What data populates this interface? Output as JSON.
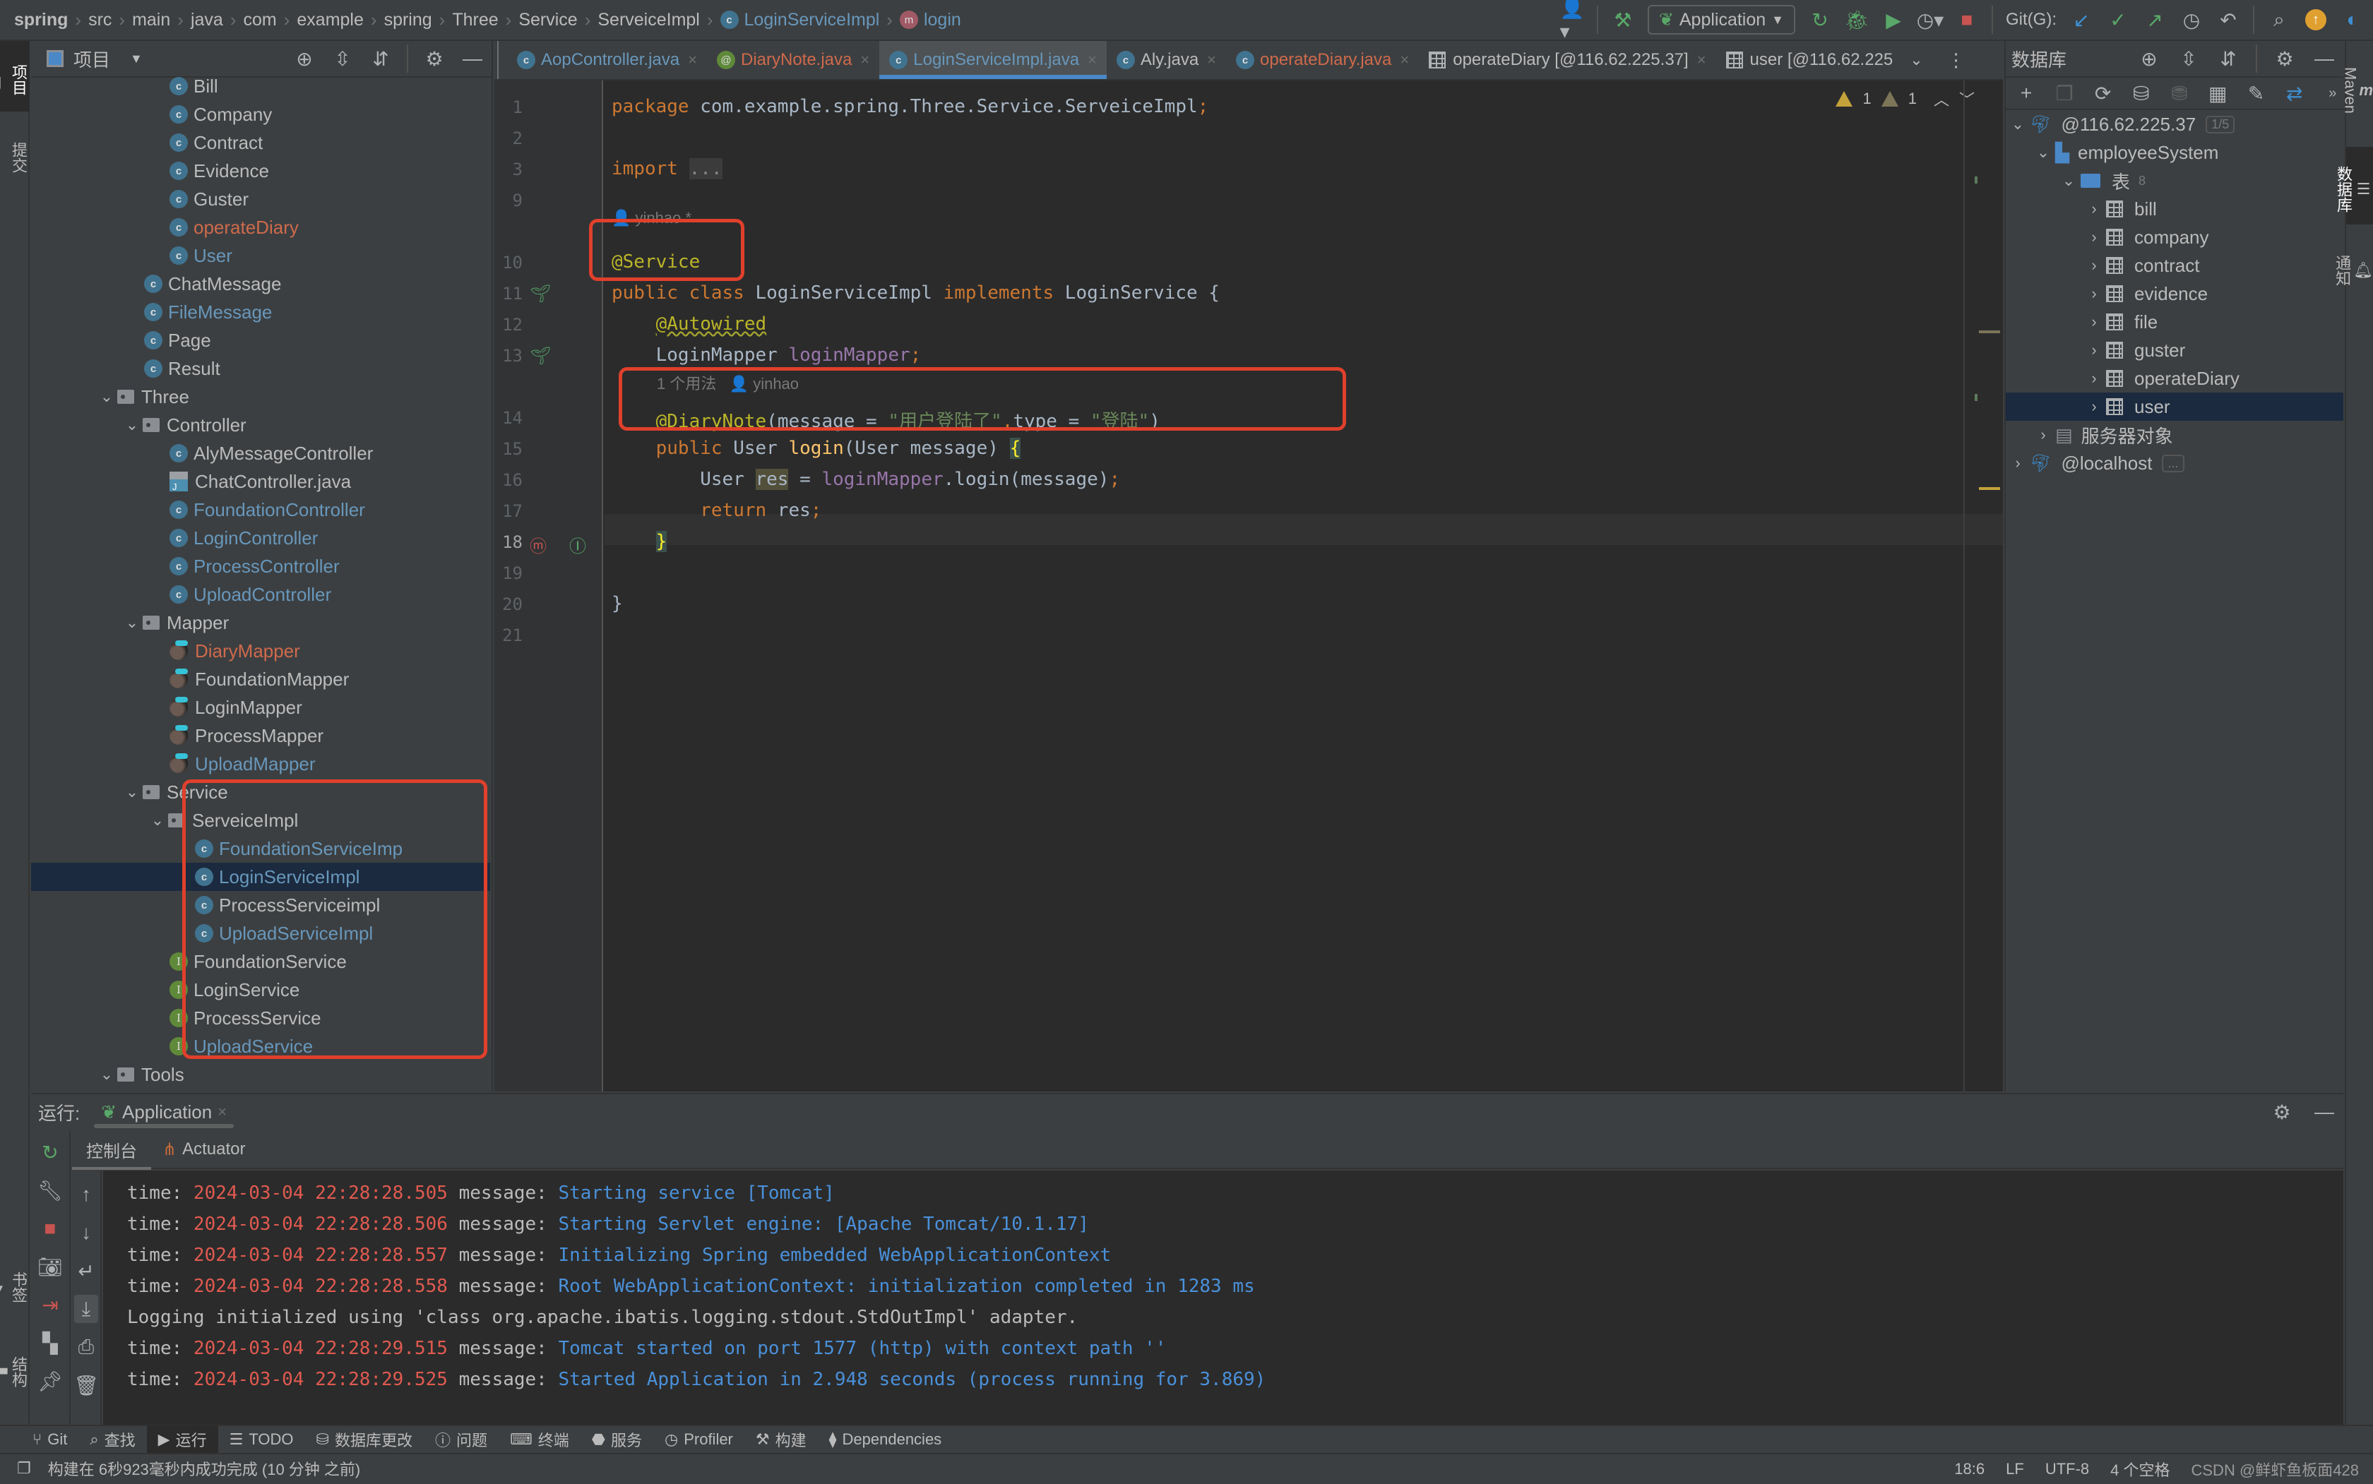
{
  "navbar": {
    "breadcrumbs": [
      "spring",
      "src",
      "main",
      "java",
      "com",
      "example",
      "spring",
      "Three",
      "Service",
      "ServeiceImpl"
    ],
    "class_crumb": "LoginServiceImpl",
    "method_crumb": "login",
    "run_config": "Application",
    "git_label": "Git(G):"
  },
  "left_strip": {
    "project_tab": "项目",
    "commit_tab": "提交",
    "bookmarks_tab": "书签",
    "structure_tab": "结构"
  },
  "project": {
    "title": "项目",
    "tree": [
      {
        "label": "Bill",
        "indent": 5,
        "icon": "class",
        "color": "def"
      },
      {
        "label": "Company",
        "indent": 5,
        "icon": "class",
        "color": "def"
      },
      {
        "label": "Contract",
        "indent": 5,
        "icon": "class",
        "color": "def"
      },
      {
        "label": "Evidence",
        "indent": 5,
        "icon": "class",
        "color": "def"
      },
      {
        "label": "Guster",
        "indent": 5,
        "icon": "class",
        "color": "def"
      },
      {
        "label": "operateDiary",
        "indent": 5,
        "icon": "class",
        "color": "red"
      },
      {
        "label": "User",
        "indent": 5,
        "icon": "class",
        "color": "blue"
      },
      {
        "label": "ChatMessage",
        "indent": 4,
        "icon": "class",
        "color": "def"
      },
      {
        "label": "FileMessage",
        "indent": 4,
        "icon": "class",
        "color": "blue"
      },
      {
        "label": "Page",
        "indent": 4,
        "icon": "class",
        "color": "def"
      },
      {
        "label": "Result",
        "indent": 4,
        "icon": "class",
        "color": "def"
      },
      {
        "label": "Three",
        "indent": 3,
        "icon": "folder",
        "color": "def",
        "expanded": true
      },
      {
        "label": "Controller",
        "indent": 4,
        "icon": "folder",
        "color": "def",
        "expanded": true
      },
      {
        "label": "AlyMessageController",
        "indent": 5,
        "icon": "class",
        "color": "def"
      },
      {
        "label": "ChatController.java",
        "indent": 5,
        "icon": "javafile",
        "color": "def"
      },
      {
        "label": "FoundationController",
        "indent": 5,
        "icon": "class",
        "color": "blue"
      },
      {
        "label": "LoginController",
        "indent": 5,
        "icon": "class",
        "color": "blue"
      },
      {
        "label": "ProcessController",
        "indent": 5,
        "icon": "class",
        "color": "blue"
      },
      {
        "label": "UploadController",
        "indent": 5,
        "icon": "class",
        "color": "blue"
      },
      {
        "label": "Mapper",
        "indent": 4,
        "icon": "folder",
        "color": "def",
        "expanded": true
      },
      {
        "label": "DiaryMapper",
        "indent": 5,
        "icon": "mapper",
        "color": "red"
      },
      {
        "label": "FoundationMapper",
        "indent": 5,
        "icon": "mapper",
        "color": "def"
      },
      {
        "label": "LoginMapper",
        "indent": 5,
        "icon": "mapper",
        "color": "def"
      },
      {
        "label": "ProcessMapper",
        "indent": 5,
        "icon": "mapper",
        "color": "def"
      },
      {
        "label": "UploadMapper",
        "indent": 5,
        "icon": "mapper",
        "color": "blue"
      },
      {
        "label": "Service",
        "indent": 4,
        "icon": "folder",
        "color": "def",
        "expanded": true
      },
      {
        "label": "ServeiceImpl",
        "indent": 5,
        "icon": "folder",
        "color": "def",
        "expanded": true
      },
      {
        "label": "FoundationServiceImp",
        "indent": 6,
        "icon": "class",
        "color": "blue"
      },
      {
        "label": "LoginServiceImpl",
        "indent": 6,
        "icon": "class",
        "color": "blue",
        "selected": true
      },
      {
        "label": "ProcessServiceimpl",
        "indent": 6,
        "icon": "class",
        "color": "def"
      },
      {
        "label": "UploadServiceImpl",
        "indent": 6,
        "icon": "class",
        "color": "blue"
      },
      {
        "label": "FoundationService",
        "indent": 5,
        "icon": "interface",
        "color": "def"
      },
      {
        "label": "LoginService",
        "indent": 5,
        "icon": "interface",
        "color": "def"
      },
      {
        "label": "ProcessService",
        "indent": 5,
        "icon": "interface",
        "color": "def"
      },
      {
        "label": "UploadService",
        "indent": 5,
        "icon": "interface",
        "color": "blue"
      },
      {
        "label": "Tools",
        "indent": 3,
        "icon": "folder",
        "color": "def",
        "expanded": true
      }
    ]
  },
  "tabs": [
    {
      "label": "AopController.java",
      "icon": "class",
      "color": "blue"
    },
    {
      "label": "DiaryNote.java",
      "icon": "annotation",
      "color": "red"
    },
    {
      "label": "LoginServiceImpl.java",
      "icon": "class",
      "color": "blue",
      "active": true
    },
    {
      "label": "Aly.java",
      "icon": "class",
      "color": "def"
    },
    {
      "label": "operateDiary.java",
      "icon": "class",
      "color": "red"
    },
    {
      "label": "operateDiary [@116.62.225.37]",
      "icon": "table",
      "color": "def"
    },
    {
      "label": "user [@116.62.225",
      "icon": "table",
      "color": "def"
    }
  ],
  "editor": {
    "inspection": {
      "warnings": "1",
      "weak_warnings": "1"
    },
    "author_hint_class": "yinhao *",
    "usage_hint": "1 个用法",
    "author_hint_method": "yinhao",
    "lines": [
      {
        "n": "1",
        "html": "<span class=\"kw\">package</span> com.example.spring.Three.Service.ServeiceImpl<span class=\"kw\">;</span>"
      },
      {
        "n": "2",
        "html": ""
      },
      {
        "n": "3",
        "html": "<span class=\"kw\">import</span> <span style=\"background:#3b3b3b;color:#888\">...</span>"
      },
      {
        "n": "9",
        "html": ""
      },
      {
        "n": "10",
        "html": "<span class=\"ann\">@Service</span>"
      },
      {
        "n": "11",
        "html": "<span class=\"kw\">public class</span> LoginServiceImpl <span class=\"kw\">implements</span> LoginService {"
      },
      {
        "n": "12",
        "html": "    <span class=\"ann\" style=\"text-decoration:underline wavy #a0a030\">@Autowired</span>"
      },
      {
        "n": "13",
        "html": "    LoginMapper <span class=\"fld\">loginMapper</span><span class=\"kw\">;</span>"
      },
      {
        "n": "14",
        "html": "    <span class=\"ann\">@DiaryNote</span>(message = <span class=\"str\">\"用户登陆了\"</span><span class=\"kw\">,</span>type = <span class=\"str\">\"登陆\"</span>)"
      },
      {
        "n": "15",
        "html": "    <span class=\"kw\">public</span> User <span class=\"fn\">login</span>(User message) <span style=\"background:#3b514d;color:#ffef28\">{</span>"
      },
      {
        "n": "16",
        "html": "        User <span style=\"background:#52503a\">res</span> = <span class=\"fld\">loginMapper</span>.login(message)<span class=\"kw\">;</span>"
      },
      {
        "n": "17",
        "html": "        <span class=\"kw\">return</span> res<span class=\"kw\">;</span>"
      },
      {
        "n": "18",
        "html": "    <span style=\"background:#3b514d;color:#ffef28\">}</span>"
      },
      {
        "n": "19",
        "html": ""
      },
      {
        "n": "20",
        "html": "}"
      },
      {
        "n": "21",
        "html": ""
      }
    ],
    "current_line": "18"
  },
  "database": {
    "title": "数据库",
    "host": "@116.62.225.37",
    "host_badge": "1/5",
    "schema": "employeeSystem",
    "tables_folder": "表",
    "tables_count": "8",
    "tables": [
      "bill",
      "company",
      "contract",
      "evidence",
      "file",
      "guster",
      "operateDiary",
      "user"
    ],
    "selected_table": "user",
    "server_objects": "服务器对象",
    "localhost": "@localhost",
    "localhost_badge": "..."
  },
  "right_strip": {
    "maven": "Maven",
    "database": "数据库",
    "notifications": "通知"
  },
  "run": {
    "label": "运行:",
    "config_tab": "Application",
    "subtabs": [
      "控制台",
      "Actuator"
    ],
    "console": [
      {
        "prefix": "time: ",
        "time": "2024-03-04 22:28:28.505",
        "mid": " message: ",
        "msg": "Starting service [Tomcat]"
      },
      {
        "prefix": "time: ",
        "time": "2024-03-04 22:28:28.506",
        "mid": " message: ",
        "msg": "Starting Servlet engine: [Apache Tomcat/10.1.17]"
      },
      {
        "prefix": "time: ",
        "time": "2024-03-04 22:28:28.557",
        "mid": " message: ",
        "msg": "Initializing Spring embedded WebApplicationContext"
      },
      {
        "prefix": "time: ",
        "time": "2024-03-04 22:28:28.558",
        "mid": " message: ",
        "msg": "Root WebApplicationContext: initialization completed in 1283 ms"
      },
      {
        "prefix": "Logging initialized using 'class org.apache.ibatis.logging.stdout.StdOutImpl' adapter.",
        "time": "",
        "mid": "",
        "msg": ""
      },
      {
        "prefix": "time: ",
        "time": "2024-03-04 22:28:29.515",
        "mid": " message: ",
        "msg": "Tomcat started on port 1577 (http) with context path ''"
      },
      {
        "prefix": "time: ",
        "time": "2024-03-04 22:28:29.525",
        "mid": " message: ",
        "msg": "Started Application in 2.948 seconds (process running for 3.869)"
      }
    ]
  },
  "bottom_tabs": [
    {
      "label": "Git",
      "icon": "git-icon"
    },
    {
      "label": "查找",
      "icon": "search-icon"
    },
    {
      "label": "运行",
      "icon": "run-icon",
      "active": true
    },
    {
      "label": "TODO",
      "icon": "list-icon"
    },
    {
      "label": "数据库更改",
      "icon": "db-changes-icon"
    },
    {
      "label": "问题",
      "icon": "problems-icon"
    },
    {
      "label": "终端",
      "icon": "terminal-icon"
    },
    {
      "label": "服务",
      "icon": "services-icon"
    },
    {
      "label": "Profiler",
      "icon": "profiler-icon"
    },
    {
      "label": "构建",
      "icon": "build-icon"
    },
    {
      "label": "Dependencies",
      "icon": "dependencies-icon"
    }
  ],
  "status": {
    "message": "构建在 6秒923毫秒内成功完成 (10 分钟 之前)",
    "position": "18:6",
    "line_sep": "LF",
    "encoding": "UTF-8",
    "indent": "4 个空格",
    "watermark": "CSDN @鲜虾鱼板面428"
  }
}
